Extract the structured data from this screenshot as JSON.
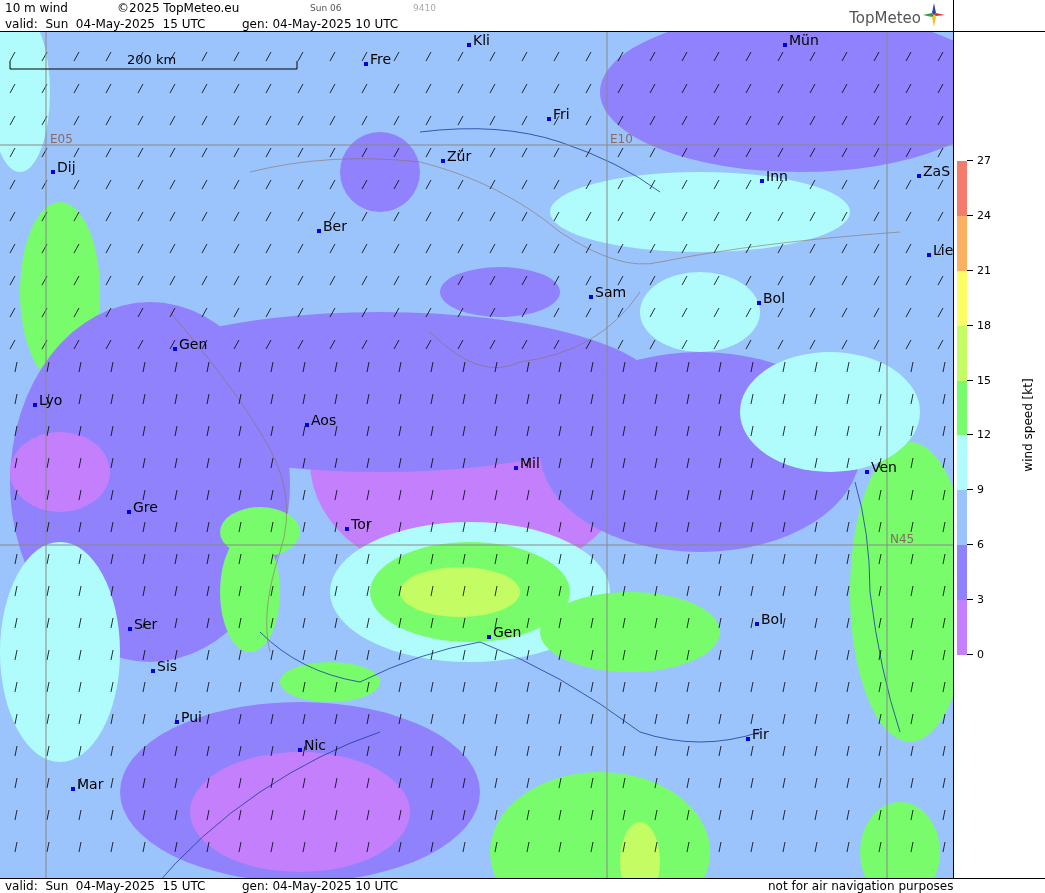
{
  "header": {
    "title": "10 m wind",
    "copyright": "©2025 TopMeteo.eu",
    "day_code": "Sun 06",
    "run_code": "9410",
    "valid": "valid:  Sun  04-May-2025  15 UTC",
    "generated": "gen: 04-May-2025 10 UTC",
    "logo": "TopMeteo"
  },
  "map": {
    "scale": "200 km",
    "grid_labels": [
      "E05",
      "E10",
      "N45"
    ],
    "cities": [
      "Kli",
      "Mün",
      "Fre",
      "Fri",
      "Dij",
      "Zür",
      "Inn",
      "ZaS",
      "Ber",
      "Lie",
      "Sam",
      "Bol",
      "Gen",
      "Lyo",
      "Aos",
      "Mil",
      "Ven",
      "Gre",
      "Tor",
      "Ser",
      "Bol",
      "Gen",
      "Sis",
      "Pui",
      "Nic",
      "Fir",
      "Mar"
    ]
  },
  "legend": {
    "title": "wind speed [kt]",
    "ticks": [
      "27",
      "24",
      "21",
      "18",
      "15",
      "12",
      "9",
      "6",
      "3",
      "0"
    ],
    "bands": [
      {
        "color": "#f47c6c"
      },
      {
        "color": "#fcb064"
      },
      {
        "color": "#fcfc64"
      },
      {
        "color": "#c4fc64"
      },
      {
        "color": "#78fc6c"
      },
      {
        "color": "#b0fcfc"
      },
      {
        "color": "#9cc4fc"
      },
      {
        "color": "#9082fc"
      },
      {
        "color": "#c480fc"
      }
    ]
  },
  "footer": {
    "valid": "valid:  Sun  04-May-2025  15 UTC",
    "generated": "gen: 04-May-2025 10 UTC",
    "notice": "not for air navigation purposes"
  }
}
